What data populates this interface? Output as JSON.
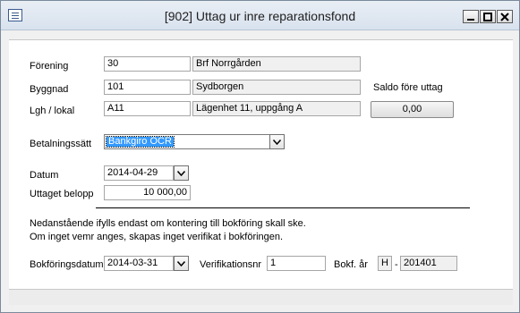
{
  "window": {
    "title": "[902]  Uttag ur inre reparationsfond"
  },
  "form": {
    "forening": {
      "label": "Förening",
      "value": "30",
      "name": "Brf Norrgården"
    },
    "byggnad": {
      "label": "Byggnad",
      "value": "101",
      "name": "Sydborgen"
    },
    "lgh": {
      "label": "Lgh / lokal",
      "value": "A11",
      "name": "Lägenhet 11, uppgång A"
    },
    "saldo": {
      "label": "Saldo före uttag",
      "value": "0,00"
    },
    "betalning": {
      "label": "Betalningssätt",
      "value": "Bankgiro OCR"
    },
    "datum": {
      "label": "Datum",
      "value": "2014-04-29"
    },
    "belopp": {
      "label": "Uttaget belopp",
      "value": "10 000,00"
    },
    "info_line1": "Nedanstående ifylls endast om kontering till bokföring skall ske.",
    "info_line2": "Om inget vemr anges, skapas inget verifikat i bokföringen.",
    "bokforingsdatum": {
      "label": "Bokföringsdatum",
      "value": "2014-03-31"
    },
    "verifikationsnr": {
      "label": "Verifikationsnr",
      "value": "1"
    },
    "bokf_ar": {
      "label": "Bokf. år",
      "series": "H",
      "separator": "-",
      "value": "201401"
    }
  }
}
